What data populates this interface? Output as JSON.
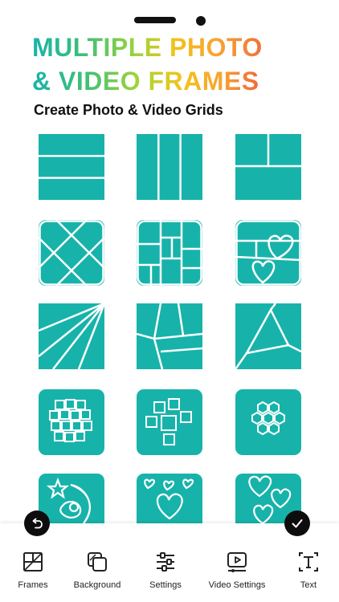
{
  "header": {
    "title_line1": "MULTIPLE PHOTO",
    "title_line2": "& VIDEO FRAMES",
    "subtitle": "Create Photo & Video Grids"
  },
  "colors": {
    "tile": "#17b3aa",
    "line": "#ffffff",
    "fab": "#0d0d0d"
  },
  "frames": [
    {
      "id": "frame-horizontal-3",
      "icon": "three-rows-frame-icon"
    },
    {
      "id": "frame-vertical-3",
      "icon": "three-columns-frame-icon"
    },
    {
      "id": "frame-mixed-3",
      "icon": "split-frame-icon"
    },
    {
      "id": "frame-diagonal-strips",
      "icon": "diagonal-frame-icon"
    },
    {
      "id": "frame-mosaic",
      "icon": "mosaic-frame-icon"
    },
    {
      "id": "frame-hearts",
      "icon": "hearts-frame-icon"
    },
    {
      "id": "frame-fan",
      "icon": "fan-frame-icon"
    },
    {
      "id": "frame-shards",
      "icon": "shards-frame-icon"
    },
    {
      "id": "frame-triangle",
      "icon": "triangle-frame-icon"
    },
    {
      "id": "frame-squares-cluster",
      "icon": "squares-cluster-frame-icon"
    },
    {
      "id": "frame-scattered-squares",
      "icon": "scattered-squares-frame-icon"
    },
    {
      "id": "frame-hexagons",
      "icon": "hexagon-frame-icon"
    },
    {
      "id": "frame-moon-star",
      "icon": "moon-star-frame-icon"
    },
    {
      "id": "frame-many-hearts",
      "icon": "many-hearts-frame-icon"
    },
    {
      "id": "frame-heart-trio",
      "icon": "heart-trio-frame-icon"
    }
  ],
  "toolbar": {
    "frames": "Frames",
    "background": "Background",
    "settings": "Settings",
    "video_settings": "Video Settings",
    "text": "Text"
  },
  "actions": {
    "undo_icon": "undo-icon",
    "confirm_icon": "check-icon"
  }
}
